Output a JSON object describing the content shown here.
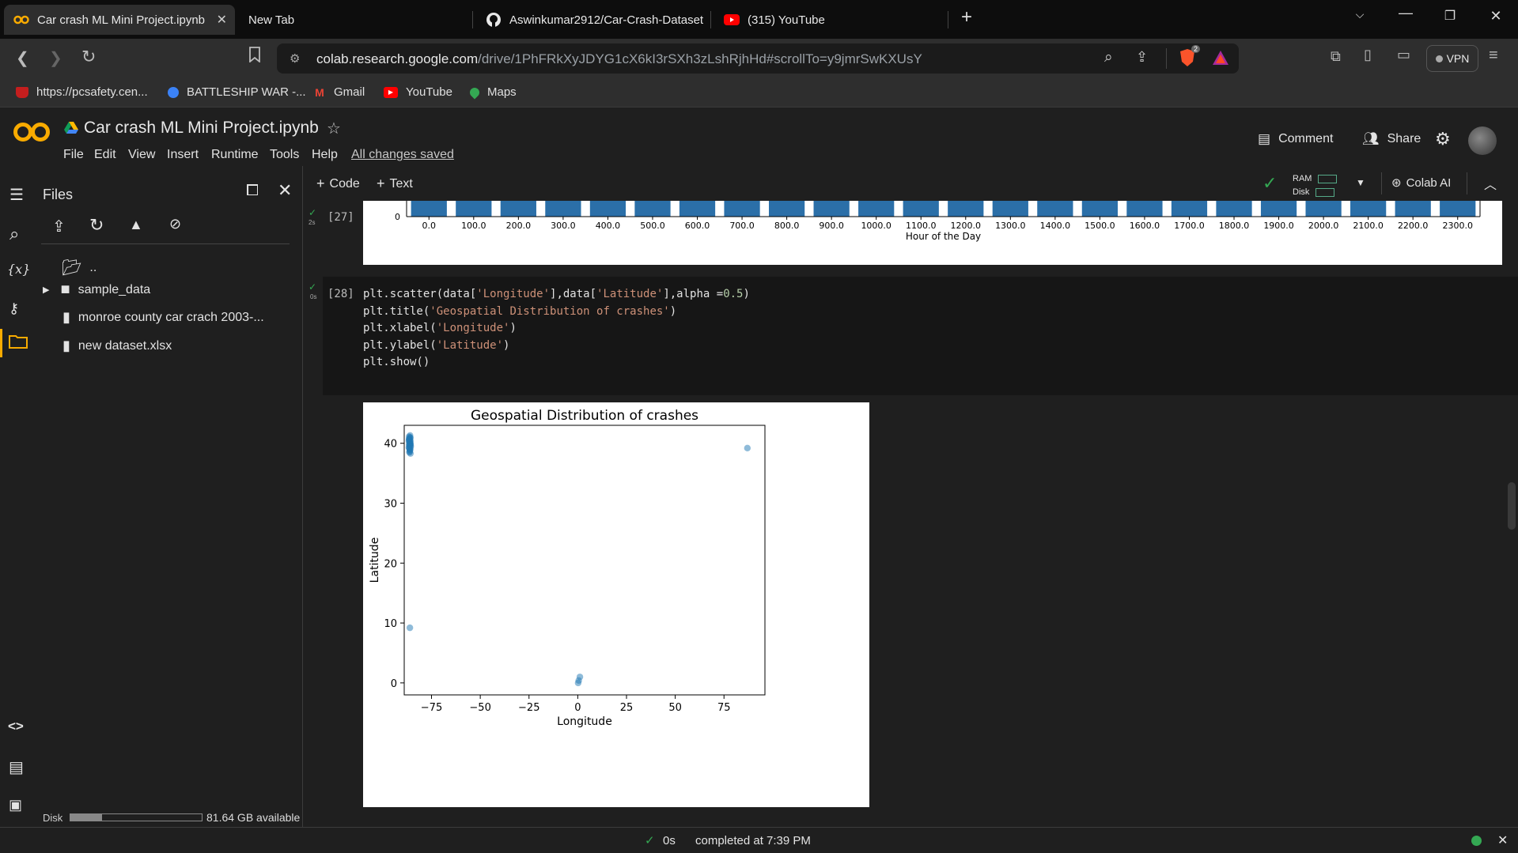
{
  "browser": {
    "tabs": [
      {
        "title": "Car crash ML Mini Project.ipynb",
        "active": true
      },
      {
        "title": "New Tab",
        "active": false
      },
      {
        "title": "Aswinkumar2912/Car-Crash-Dataset",
        "active": false
      },
      {
        "title": "(315) YouTube",
        "active": false
      }
    ],
    "url_host": "colab.research.google.com",
    "url_path": "/drive/1PhFRkXyJDYG1cX6kI3rSXh3zLshRjhHd#scrollTo=y9jmrSwKXUsY",
    "vpn_label": "VPN",
    "brave_badge": "2",
    "bookmarks": [
      {
        "label": "https://pcsafety.cen...",
        "icon": "shield-icon"
      },
      {
        "label": "BATTLESHIP WAR -...",
        "icon": "globe-icon"
      },
      {
        "label": "Gmail",
        "icon": "gmail-icon"
      },
      {
        "label": "YouTube",
        "icon": "youtube-icon"
      },
      {
        "label": "Maps",
        "icon": "maps-icon"
      }
    ]
  },
  "colab": {
    "logo": "CO",
    "notebook_title": "Car crash ML Mini Project.ipynb",
    "menu": [
      "File",
      "Edit",
      "View",
      "Insert",
      "Runtime",
      "Tools",
      "Help"
    ],
    "save_status": "All changes saved",
    "comment_label": "Comment",
    "share_label": "Share",
    "add_code_label": "Code",
    "add_text_label": "Text",
    "ram_label": "RAM",
    "disk_label": "Disk",
    "colab_ai_label": "Colab AI"
  },
  "files_panel": {
    "title": "Files",
    "items": [
      {
        "name": "..",
        "type": "folder"
      },
      {
        "name": "sample_data",
        "type": "folder"
      },
      {
        "name": "monroe county car crach 2003-...",
        "type": "file"
      },
      {
        "name": "new dataset.xlsx",
        "type": "file"
      }
    ],
    "disk_label": "Disk",
    "disk_available": "81.64 GB available",
    "disk_used_fraction": 0.24
  },
  "cells": {
    "prev_cell": {
      "exec_count": "[27]",
      "exec_time": "2s",
      "x_ticks": [
        "0.0",
        "100.0",
        "200.0",
        "300.0",
        "400.0",
        "500.0",
        "600.0",
        "700.0",
        "800.0",
        "900.0",
        "1000.0",
        "1100.0",
        "1200.0",
        "1300.0",
        "1400.0",
        "1500.0",
        "1600.0",
        "1700.0",
        "1800.0",
        "1900.0",
        "2000.0",
        "2100.0",
        "2200.0",
        "2300.0"
      ],
      "y_tick": "0",
      "xlabel": "Hour of the Day",
      "bar_color": "#2b6fa8"
    },
    "current_cell": {
      "exec_count": "[28]",
      "exec_time": "0s",
      "code_lines": [
        "plt.scatter(data['Longitude'],data['Latitude'],alpha =0.5)",
        "plt.title('Geospatial Distribution of crashes')",
        "plt.xlabel('Longitude')",
        "plt.ylabel('Latitude')",
        "plt.show()"
      ]
    }
  },
  "chart_data": {
    "type": "scatter",
    "title": "Geospatial Distribution of crashes",
    "xlabel": "Longitude",
    "ylabel": "Latitude",
    "xlim": [
      -89,
      96
    ],
    "ylim": [
      -2,
      43
    ],
    "x_ticks": [
      -75,
      -50,
      -25,
      0,
      25,
      50,
      75
    ],
    "y_ticks": [
      0,
      10,
      20,
      30,
      40
    ],
    "grid": false,
    "color": "#1f77b4",
    "alpha": 0.5,
    "series": [
      {
        "x": [
          -86.5,
          -86.3,
          -86.0,
          -85.8,
          -86.6,
          -86.2,
          -85.9,
          -86.4,
          -86.1,
          -85.7,
          -86.5,
          -86.0,
          -86.3,
          -85.8,
          -86.2,
          -86.6,
          -85.9,
          -86.1,
          -86.4,
          -86.0,
          -86.3,
          -85.7,
          -86.2,
          -86.5,
          -85.9,
          -86.1,
          -86.0,
          -86.4,
          -85.8,
          -86.2
        ],
        "y": [
          40.7,
          40.2,
          39.8,
          40.9,
          40.4,
          39.5,
          40.0,
          39.2,
          38.8,
          39.6,
          41.1,
          40.5,
          38.5,
          39.9,
          40.8,
          39.3,
          40.3,
          38.9,
          39.7,
          41.3,
          40.1,
          39.4,
          38.6,
          40.6,
          39.0,
          41.0,
          40.4,
          39.8,
          38.3,
          39.1
        ]
      },
      {
        "x": [
          -86.1
        ],
        "y": [
          9.2
        ]
      },
      {
        "x": [
          0.2,
          1.1,
          0.5
        ],
        "y": [
          0.0,
          1.0,
          0.4
        ]
      },
      {
        "x": [
          87.0
        ],
        "y": [
          39.2
        ]
      }
    ]
  },
  "status": {
    "exec_time": "0s",
    "message": "completed at 7:39 PM"
  }
}
